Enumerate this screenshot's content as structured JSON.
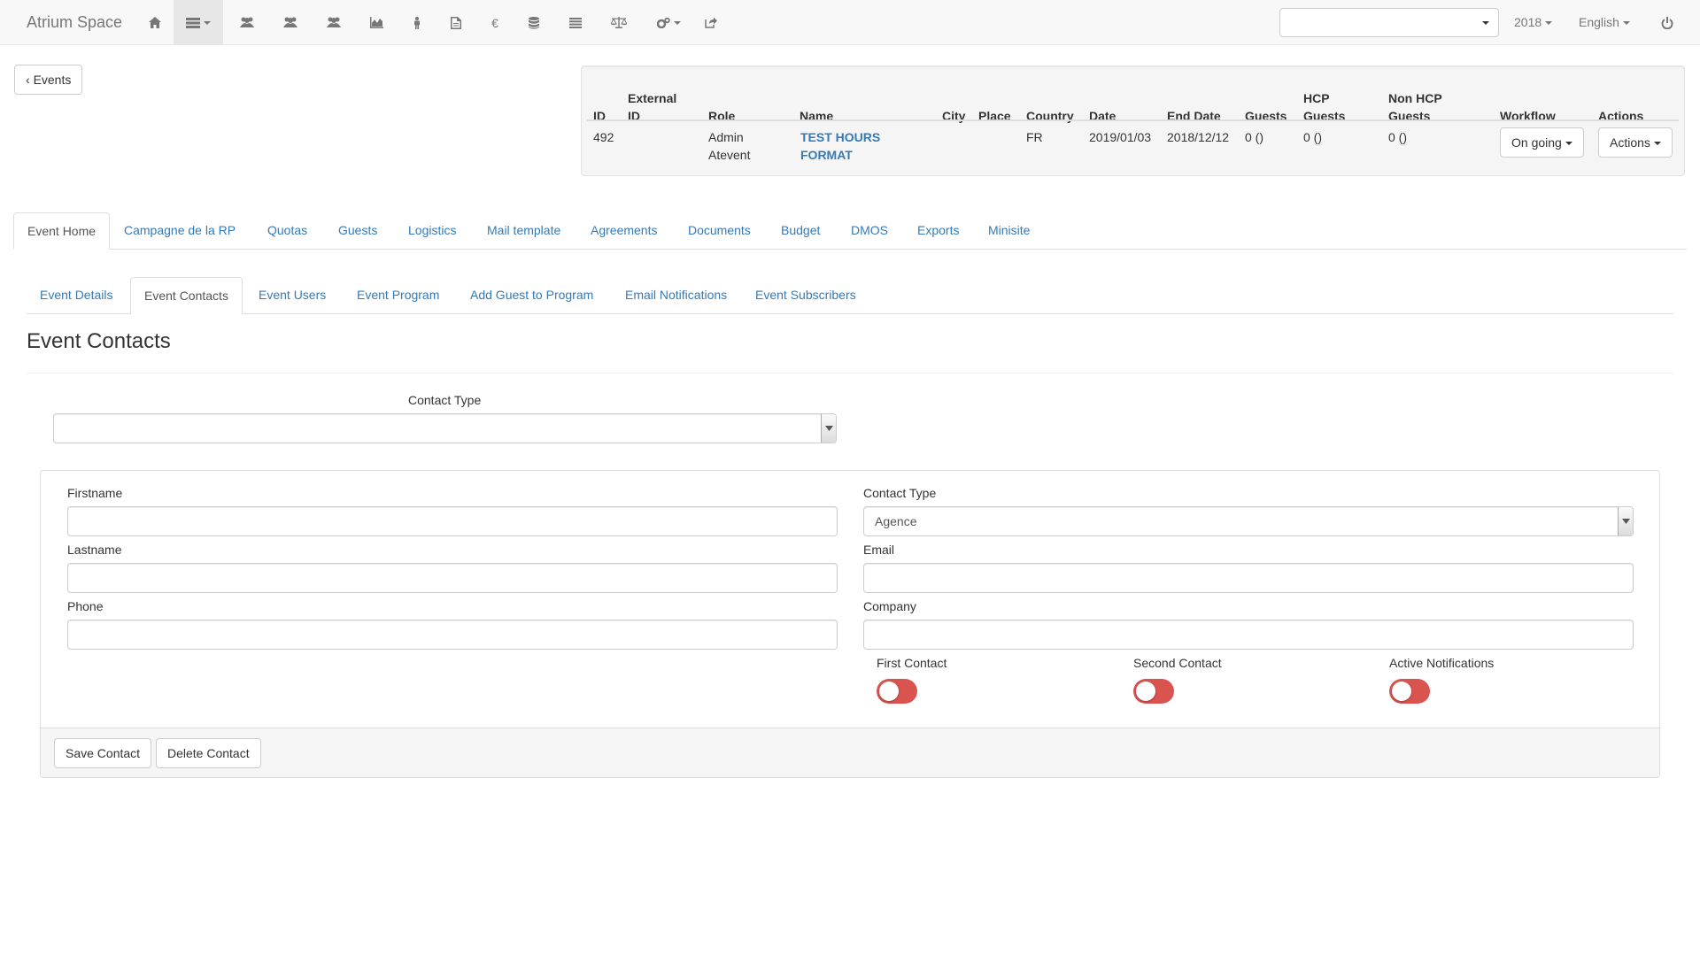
{
  "navbar": {
    "brand": "Atrium Space",
    "icons": [
      "home-icon",
      "list-menu-icon",
      "users-icon",
      "users-icon",
      "users-icon",
      "chart-icon",
      "person-icon",
      "document-icon",
      "euro-icon",
      "database-icon",
      "list-icon",
      "balance-scale-icon",
      "cogs-icon",
      "share-icon"
    ],
    "year": "2018",
    "language": "English",
    "search_value": ""
  },
  "back_button": "Events",
  "summary": {
    "headers": {
      "id": "ID",
      "external_id_1": "External",
      "external_id_2": "ID",
      "role": "Role",
      "name": "Name",
      "city": "City",
      "place": "Place",
      "country": "Country",
      "date": "Date",
      "end_date": "End Date",
      "guests": "Guests",
      "hcp_1": "HCP",
      "hcp_2": "Guests",
      "nonhcp_1": "Non HCP",
      "nonhcp_2": "Guests",
      "workflow": "Workflow",
      "actions": "Actions"
    },
    "row": {
      "id": "492",
      "external_id": "",
      "role_1": "Admin",
      "role_2": "Atevent",
      "name_1": "TEST HOURS",
      "name_2": "FORMAT",
      "city": "",
      "place": "",
      "country": "FR",
      "date": "2019/01/03",
      "end_date": "2018/12/12",
      "guests": "0 ()",
      "hcp_guests": "0 ()",
      "non_hcp_guests": "0 ()",
      "workflow": "On going",
      "actions": "Actions"
    }
  },
  "main_tabs": [
    "Event Home",
    "Campagne de la RP",
    "Quotas",
    "Guests",
    "Logistics",
    "Mail template",
    "Agreements",
    "Documents",
    "Budget",
    "DMOS",
    "Exports",
    "Minisite"
  ],
  "sub_tabs": [
    "Event Details",
    "Event Contacts",
    "Event Users",
    "Event Program",
    "Add Guest to Program",
    "Email Notifications",
    "Event Subscribers"
  ],
  "page_title": "Event Contacts",
  "filter": {
    "label": "Contact Type",
    "value": ""
  },
  "form": {
    "firstname_label": "Firstname",
    "firstname_value": "",
    "lastname_label": "Lastname",
    "lastname_value": "",
    "phone_label": "Phone",
    "phone_value": "",
    "contact_type_label": "Contact Type",
    "contact_type_value": "Agence",
    "email_label": "Email",
    "email_value": "",
    "company_label": "Company",
    "company_value": "",
    "first_contact_label": "First Contact",
    "second_contact_label": "Second Contact",
    "active_notifications_label": "Active Notifications",
    "save_button": "Save Contact",
    "delete_button": "Delete Contact"
  },
  "toggles": {
    "first_contact": false,
    "second_contact": false,
    "active_notifications": false
  },
  "colors": {
    "link": "#337ab7",
    "toggle_off": "#d9534f",
    "navbar_bg": "#f8f8f8"
  }
}
